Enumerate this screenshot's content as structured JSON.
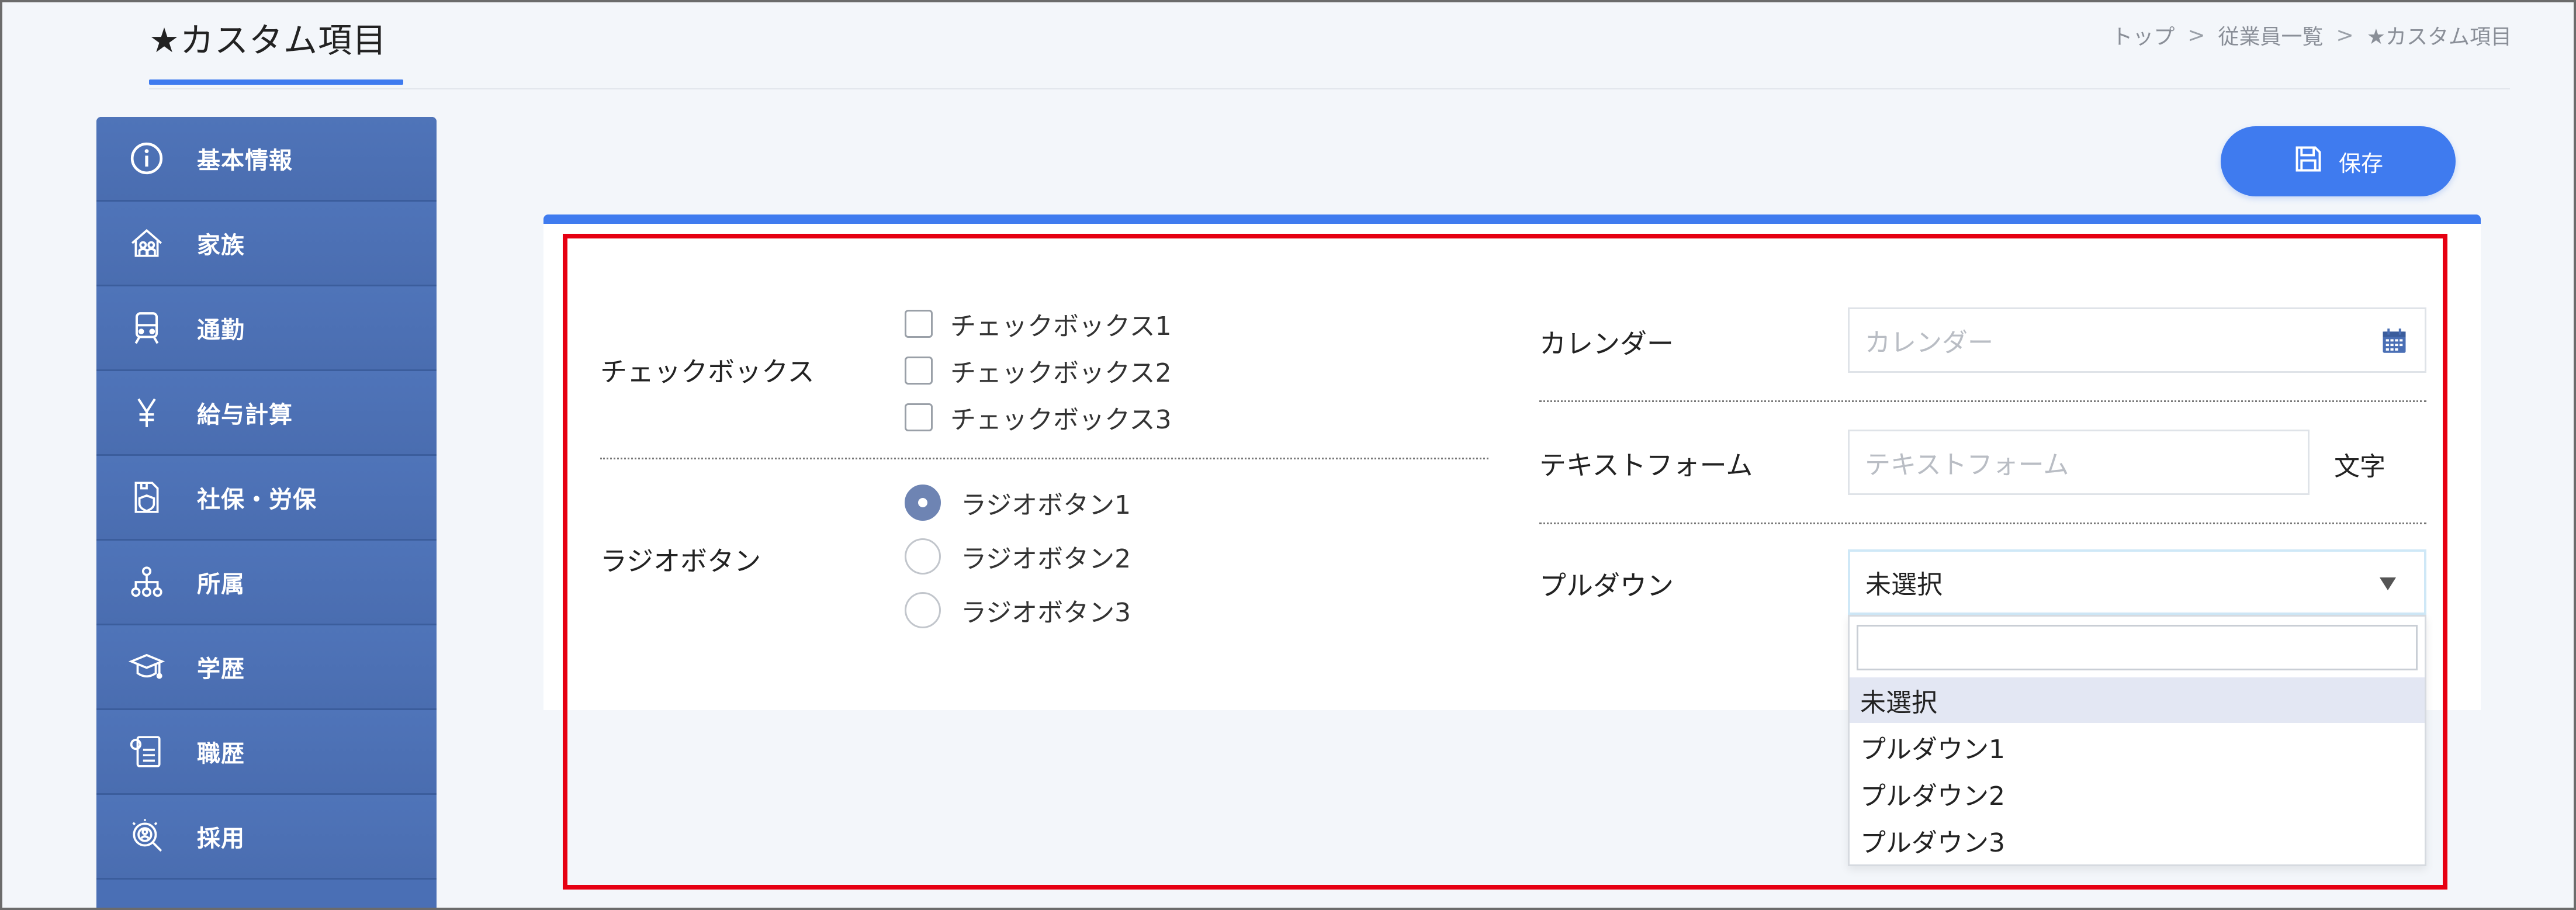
{
  "header": {
    "title": "★カスタム項目",
    "breadcrumb": [
      "トップ",
      "従業員一覧",
      "★カスタム項目"
    ],
    "breadcrumb_sep": ">"
  },
  "sidebar": {
    "items": [
      {
        "label": "基本情報",
        "icon": "info-icon"
      },
      {
        "label": "家族",
        "icon": "house-family-icon"
      },
      {
        "label": "通勤",
        "icon": "train-icon"
      },
      {
        "label": "給与計算",
        "icon": "yen-icon"
      },
      {
        "label": "社保・労保",
        "icon": "insurance-doc-icon"
      },
      {
        "label": "所属",
        "icon": "org-chart-icon"
      },
      {
        "label": "学歴",
        "icon": "graduation-cap-icon"
      },
      {
        "label": "職歴",
        "icon": "resume-icon"
      },
      {
        "label": "採用",
        "icon": "recruit-search-icon"
      }
    ]
  },
  "toolbar": {
    "save_label": "保存",
    "save_icon": "floppy-disk-icon"
  },
  "form": {
    "checkbox": {
      "label": "チェックボックス",
      "options": [
        "チェックボックス1",
        "チェックボックス2",
        "チェックボックス3"
      ]
    },
    "radio": {
      "label": "ラジオボタン",
      "options": [
        "ラジオボタン1",
        "ラジオボタン2",
        "ラジオボタン3"
      ],
      "selected_index": 0
    },
    "calendar": {
      "label": "カレンダー",
      "placeholder": "カレンダー",
      "icon": "calendar-icon"
    },
    "text": {
      "label": "テキストフォーム",
      "placeholder": "テキストフォーム",
      "suffix": "文字"
    },
    "pulldown": {
      "label": "プルダウン",
      "value": "未選択",
      "options": [
        "未選択",
        "プルダウン1",
        "プルダウン2",
        "プルダウン3"
      ]
    }
  },
  "colors": {
    "accent": "#3f7bef",
    "sidebar": "#4a6fb5",
    "highlight": "#e60012"
  }
}
